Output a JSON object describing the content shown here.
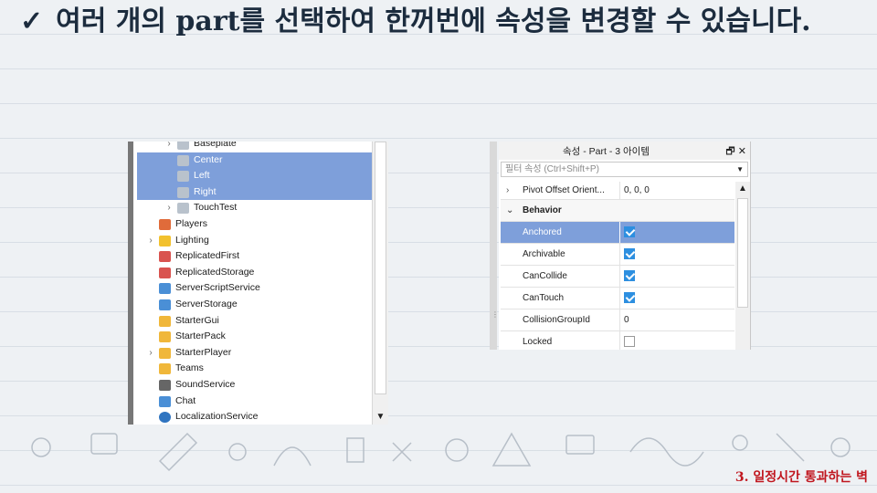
{
  "slide": {
    "title_check": "✓",
    "title": "여러 개의 part를 선택하여 한꺼번에 속성을 변경할 수 있습니다.",
    "footer": "3. 일정시간 통과하는 벽"
  },
  "explorer": {
    "items": [
      {
        "label": "Baseplate",
        "icon": "part-icon",
        "level": 2,
        "expandable": true,
        "selected": false
      },
      {
        "label": "Center",
        "icon": "part-icon",
        "level": 2,
        "expandable": false,
        "selected": true
      },
      {
        "label": "Left",
        "icon": "part-icon",
        "level": 2,
        "expandable": false,
        "selected": true
      },
      {
        "label": "Right",
        "icon": "part-icon",
        "level": 2,
        "expandable": false,
        "selected": true
      },
      {
        "label": "TouchTest",
        "icon": "part-icon",
        "level": 2,
        "expandable": true,
        "selected": false
      },
      {
        "label": "Players",
        "icon": "players-icon",
        "level": 1,
        "expandable": false,
        "selected": false
      },
      {
        "label": "Lighting",
        "icon": "lightbulb-icon",
        "level": 1,
        "expandable": true,
        "selected": false
      },
      {
        "label": "ReplicatedFirst",
        "icon": "replicated-icon",
        "level": 1,
        "expandable": false,
        "selected": false
      },
      {
        "label": "ReplicatedStorage",
        "icon": "replicated-icon",
        "level": 1,
        "expandable": false,
        "selected": false
      },
      {
        "label": "ServerScriptService",
        "icon": "server-script-icon",
        "level": 1,
        "expandable": false,
        "selected": false
      },
      {
        "label": "ServerStorage",
        "icon": "server-storage-icon",
        "level": 1,
        "expandable": false,
        "selected": false
      },
      {
        "label": "StarterGui",
        "icon": "folder-icon",
        "level": 1,
        "expandable": false,
        "selected": false
      },
      {
        "label": "StarterPack",
        "icon": "folder-icon",
        "level": 1,
        "expandable": false,
        "selected": false
      },
      {
        "label": "StarterPlayer",
        "icon": "folder-icon",
        "level": 1,
        "expandable": true,
        "selected": false
      },
      {
        "label": "Teams",
        "icon": "folder-icon",
        "level": 1,
        "expandable": false,
        "selected": false
      },
      {
        "label": "SoundService",
        "icon": "speaker-icon",
        "level": 1,
        "expandable": false,
        "selected": false
      },
      {
        "label": "Chat",
        "icon": "chat-icon",
        "level": 1,
        "expandable": false,
        "selected": false
      },
      {
        "label": "LocalizationService",
        "icon": "globe-icon",
        "level": 1,
        "expandable": false,
        "selected": false
      }
    ]
  },
  "properties": {
    "title": "속성 - Part - 3 아이템",
    "filter_placeholder": "필터 속성 (Ctrl+Shift+P)",
    "rows": [
      {
        "type": "property",
        "name": "Pivot Offset Orient...",
        "value": "0, 0, 0",
        "expandable": true
      },
      {
        "type": "group",
        "name": "Behavior",
        "expandable": true
      },
      {
        "type": "checkbox",
        "name": "Anchored",
        "checked": true,
        "selected": true
      },
      {
        "type": "checkbox",
        "name": "Archivable",
        "checked": true
      },
      {
        "type": "checkbox",
        "name": "CanCollide",
        "checked": true
      },
      {
        "type": "checkbox",
        "name": "CanTouch",
        "checked": true
      },
      {
        "type": "property",
        "name": "CollisionGroupId",
        "value": "0"
      },
      {
        "type": "checkbox",
        "name": "Locked",
        "checked": false
      }
    ]
  },
  "colors": {
    "selection": "#7e9fda",
    "checkbox": "#2d8fe0",
    "title_text": "#1c2c3e",
    "footer_text": "#c0161e"
  }
}
